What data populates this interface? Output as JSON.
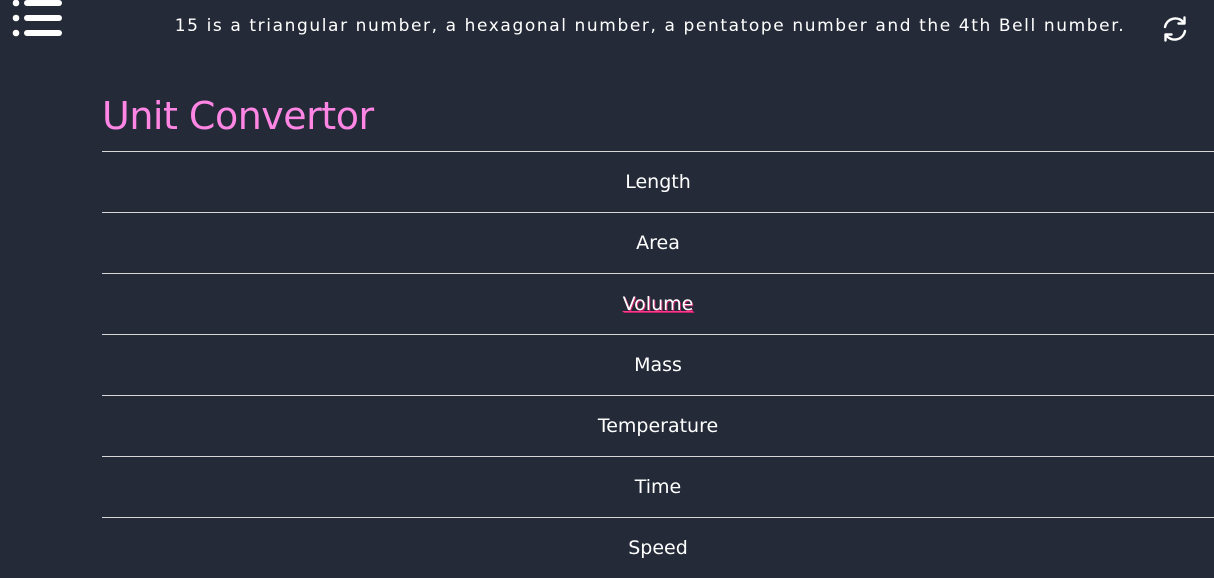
{
  "header": {
    "fact_text": "15 is a triangular number, a hexagonal number, a pentatope number and the 4th Bell number.",
    "menu_icon": "hamburger-menu-icon",
    "refresh_icon": "refresh-icon"
  },
  "main": {
    "title": "Unit Convertor",
    "items": [
      {
        "label": "Length"
      },
      {
        "label": "Area"
      },
      {
        "label": "Volume",
        "active": true
      },
      {
        "label": "Mass"
      },
      {
        "label": "Temperature"
      },
      {
        "label": "Time"
      },
      {
        "label": "Speed"
      }
    ]
  },
  "colors": {
    "background": "#242a37",
    "title": "#ff86e4",
    "active_underline": "#ff3a8c",
    "divider": "#d8d8d8",
    "text": "#ffffff"
  }
}
